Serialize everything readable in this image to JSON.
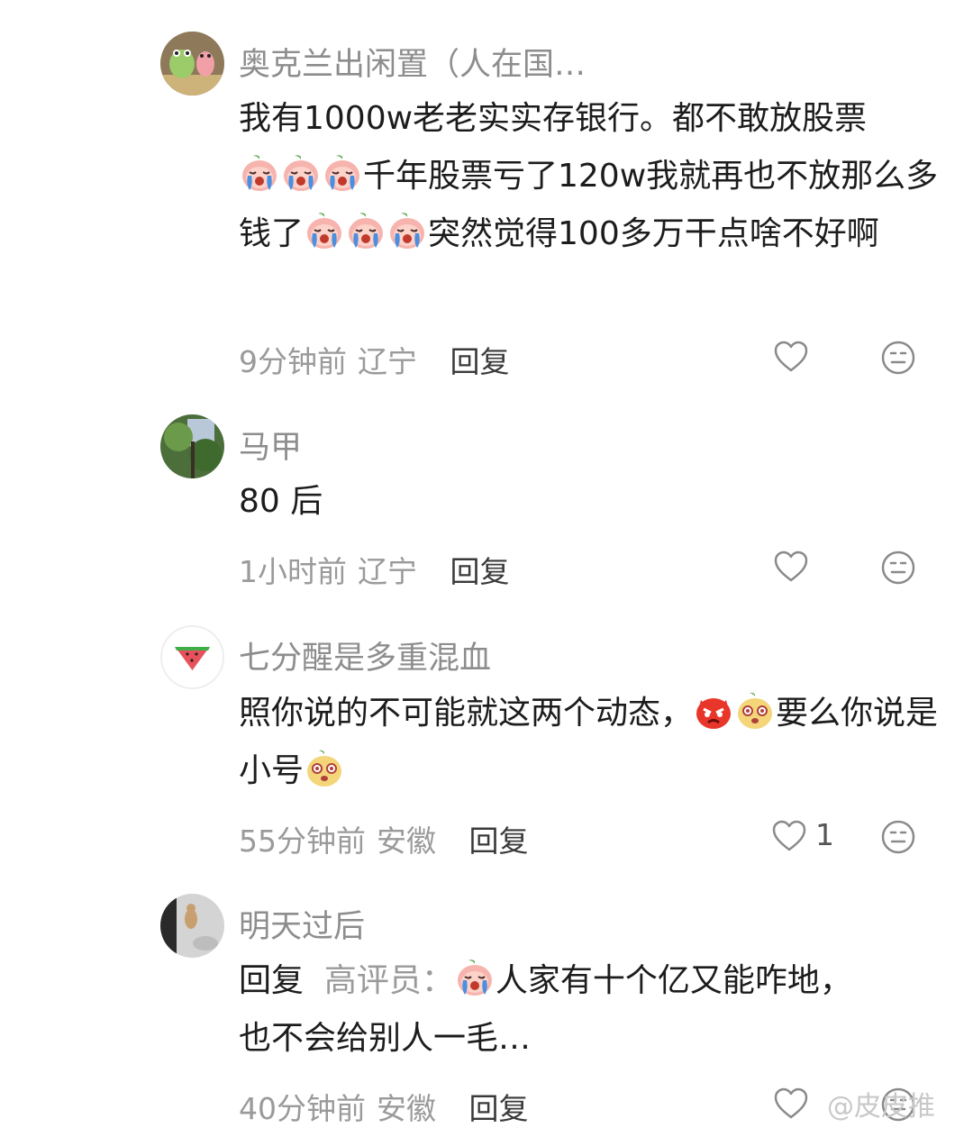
{
  "comments": [
    {
      "name": "奥克兰出闲置（人在国…",
      "text_parts": [
        "我有1000w老老实实存银行。都不敢放股票",
        "千年股票亏了120w我就再也不放那么多钱了",
        "突然觉得100多万干点啥不好啊"
      ],
      "time": "9分钟前",
      "location": "辽宁",
      "reply_label": "回复",
      "avatar_icon": "frog-avatar"
    },
    {
      "name": "马甲",
      "text": "80 后",
      "time": "1小时前",
      "location": "辽宁",
      "reply_label": "回复",
      "avatar_icon": "tree-photo-avatar"
    },
    {
      "name": "七分醒是多重混血",
      "text_parts": [
        "照你说的不可能就这两个动态，",
        "要么你说是小号"
      ],
      "time": "55分钟前",
      "location": "安徽",
      "reply_label": "回复",
      "like_count": "1",
      "avatar_icon": "watermelon-avatar"
    },
    {
      "name": "明天过后",
      "reply_prefix": "回复",
      "reply_to": "高评员：",
      "text_parts": [
        "人家有十个亿又能咋地，",
        "也不会给别人一毛…"
      ],
      "time": "40分钟前",
      "location": "安徽",
      "reply_label": "回复",
      "avatar_icon": "cat-photo-avatar"
    }
  ],
  "watermark": "@皮皮推",
  "icons": {
    "like": "heart-outline-icon",
    "dislike": "meh-face-icon",
    "crying_emoji": "crying-peach-emoji",
    "angry_emoji": "angry-red-emoji",
    "shocked_emoji": "shocked-yellow-emoji"
  },
  "colors": {
    "name": "#8d8d8d",
    "meta": "#9a9a9a",
    "text": "#1c1c1c"
  }
}
